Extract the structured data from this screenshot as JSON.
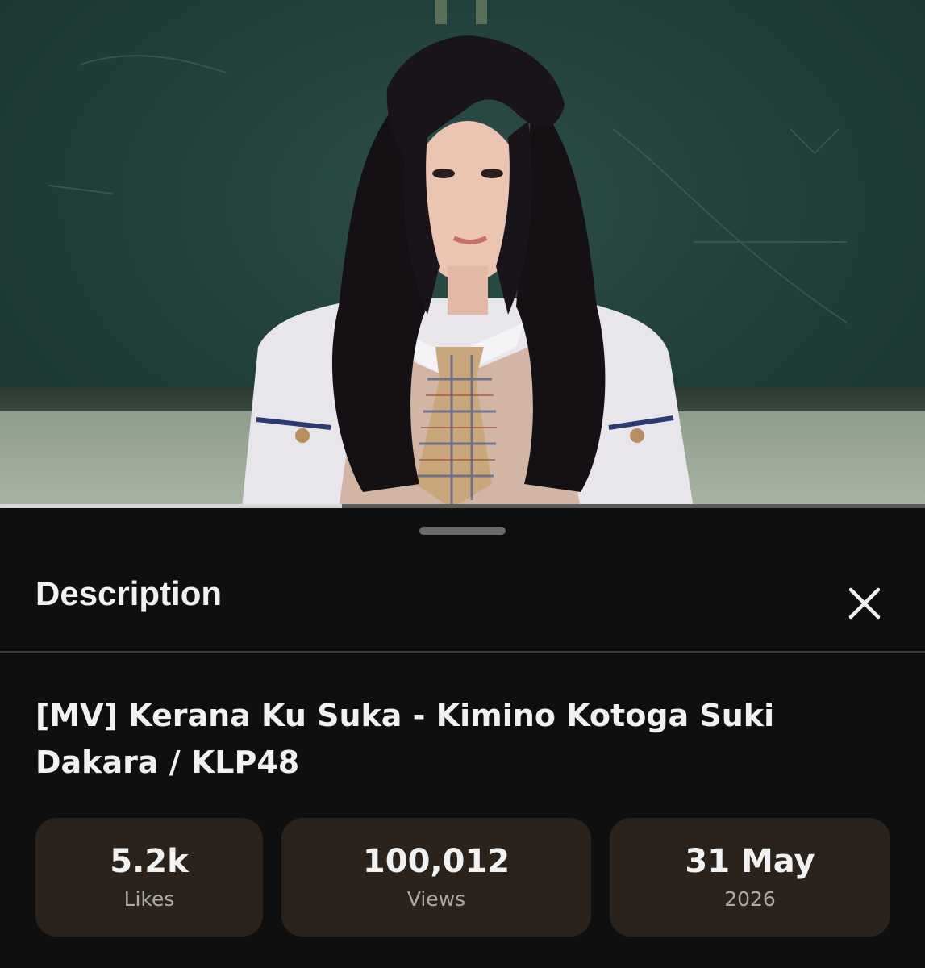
{
  "player": {
    "progress_fraction": 0.37
  },
  "sheet": {
    "title": "Description",
    "close_icon": "close-icon"
  },
  "video": {
    "title": "[MV] Kerana Ku Suka - Kimino Kotoga Suki Dakara / KLP48"
  },
  "stats": [
    {
      "value": "5.2k",
      "label": "Likes"
    },
    {
      "value": "100,012",
      "label": "Views"
    },
    {
      "value": "31 May",
      "label": "2026"
    }
  ],
  "colors": {
    "sheet_background": "#0f0f0f",
    "stat_background": "#2b231b",
    "text_primary": "#f1f1f1",
    "text_secondary": "#aaaaaa"
  }
}
